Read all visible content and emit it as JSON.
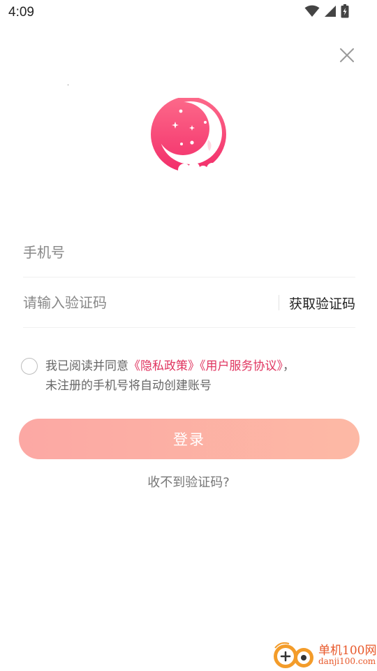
{
  "status_bar": {
    "time": "4:09"
  },
  "header": {
    "close_icon": "close-icon"
  },
  "logo": {
    "icon": "crescent-moon-stars-icon",
    "colors": {
      "gradient_top": "#fd5f86",
      "gradient_bottom": "#f5336a"
    }
  },
  "form": {
    "phone_placeholder": "手机号",
    "phone_value": "",
    "code_placeholder": "请输入验证码",
    "code_value": "",
    "get_code_label": "获取验证码"
  },
  "agreement": {
    "checked": false,
    "prefix": "我已阅读并同意",
    "privacy_link": "《隐私政策》",
    "service_link": "《用户服务协议》",
    "suffix": "，",
    "note": "未注册的手机号将自动创建账号"
  },
  "login_button": {
    "label": "登录",
    "colors": {
      "start": "#fca8a4",
      "end": "#fdb9a5"
    }
  },
  "no_code_link": "收不到验证码?",
  "watermark": {
    "name": "单机100网",
    "domain": "danji100.com"
  },
  "colors": {
    "accent": "#e0345f",
    "brand_pink": "#f5336a"
  }
}
